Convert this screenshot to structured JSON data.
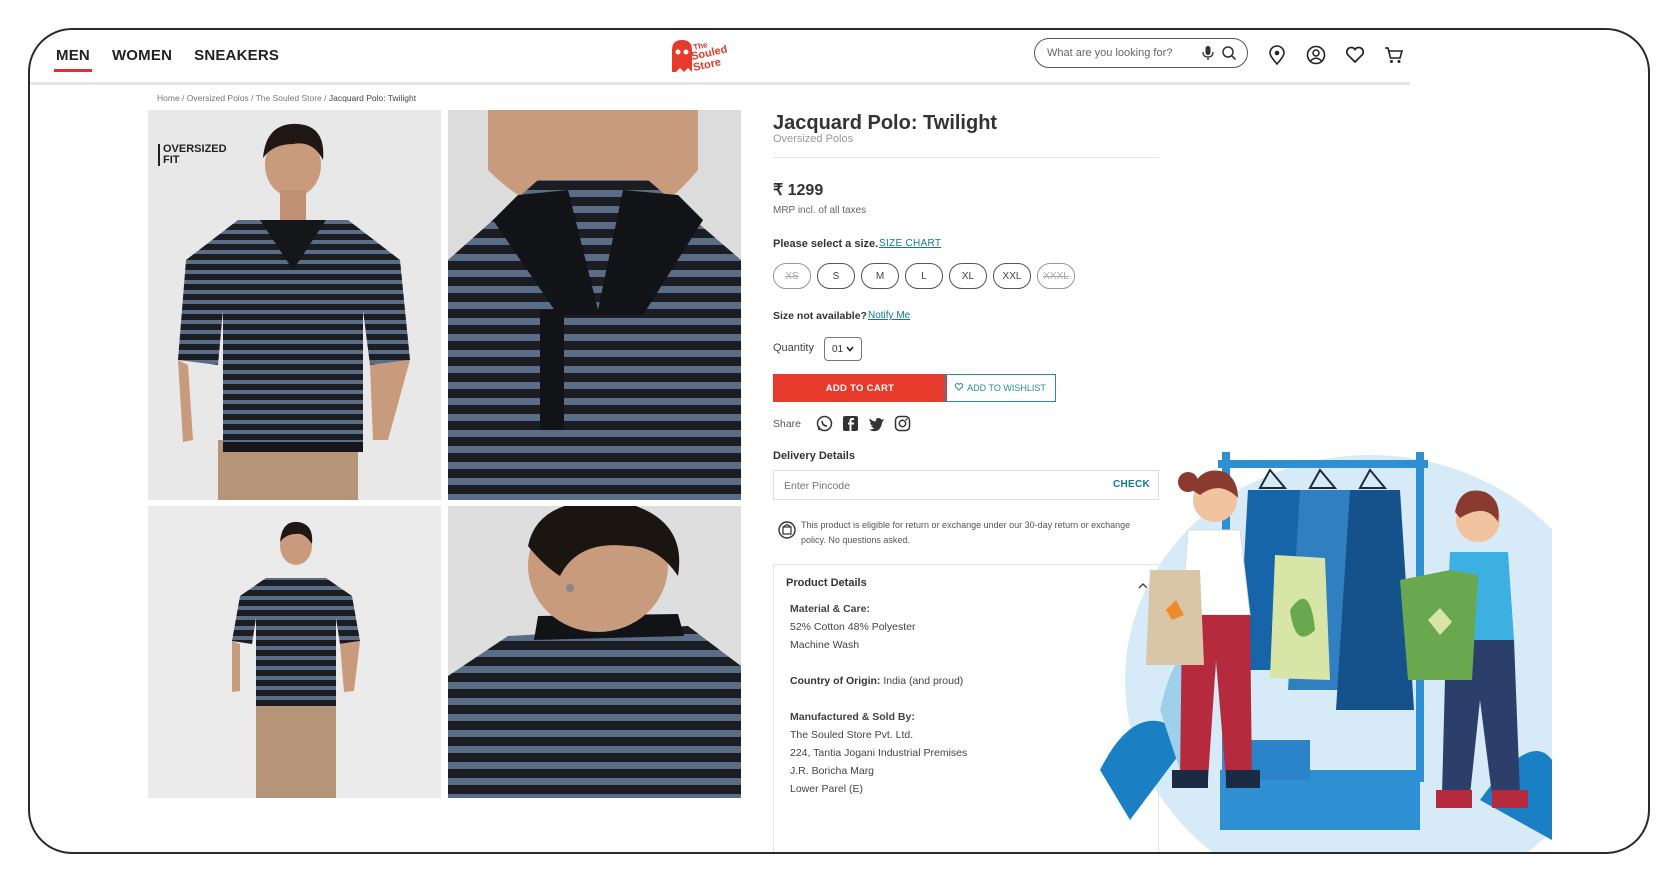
{
  "nav": {
    "items": [
      "MEN",
      "WOMEN",
      "SNEAKERS"
    ]
  },
  "logo": {
    "text": "The Souled Store"
  },
  "search": {
    "placeholder": "What are you looking for?"
  },
  "breadcrumb": {
    "items": [
      "Home",
      "Oversized Polos",
      "The Souled Store"
    ],
    "current": "Jacquard Polo: Twilight",
    "sep": " / "
  },
  "gallery": {
    "badge": "OVERSIZED FIT"
  },
  "product": {
    "title": "Jacquard Polo: Twilight",
    "category": "Oversized Polos",
    "price": "₹ 1299",
    "mrp_note": "MRP incl. of all taxes",
    "select_size_label": "Please select a size.",
    "size_chart_link": "SIZE CHART",
    "sizes": [
      {
        "label": "XS",
        "available": false
      },
      {
        "label": "S",
        "available": true
      },
      {
        "label": "M",
        "available": true
      },
      {
        "label": "L",
        "available": true
      },
      {
        "label": "XL",
        "available": true
      },
      {
        "label": "XXL",
        "available": true
      },
      {
        "label": "XXXL",
        "available": false
      }
    ],
    "size_na_label": "Size not available?",
    "notify_link": "Notify Me",
    "quantity_label": "Quantity",
    "quantity_value": "01",
    "add_to_cart": "ADD TO CART",
    "add_to_wishlist": "ADD TO WISHLIST",
    "share_label": "Share",
    "delivery_title": "Delivery Details",
    "pincode_placeholder": "Enter Pincode",
    "check_label": "CHECK",
    "return_policy": "This product is eligible for return or exchange under our 30-day return or exchange policy. No questions asked.",
    "details": {
      "title": "Product Details",
      "material_label": "Material & Care:",
      "material": "52% Cotton 48% Polyester",
      "care": "Machine Wash",
      "origin_label": "Country of Origin:",
      "origin": "India (and proud)",
      "manufacturer_label": "Manufactured & Sold By:",
      "manufacturer_lines": [
        "The Souled Store Pvt. Ltd.",
        "224, Tantia Jogani Industrial Premises",
        "J.R. Boricha Marg",
        "Lower Parel (E)"
      ]
    }
  },
  "colors": {
    "accent": "#e53a2c",
    "link": "#117a8b",
    "shirt_dark": "#1b1d22",
    "shirt_stripe": "#5a6d86"
  }
}
